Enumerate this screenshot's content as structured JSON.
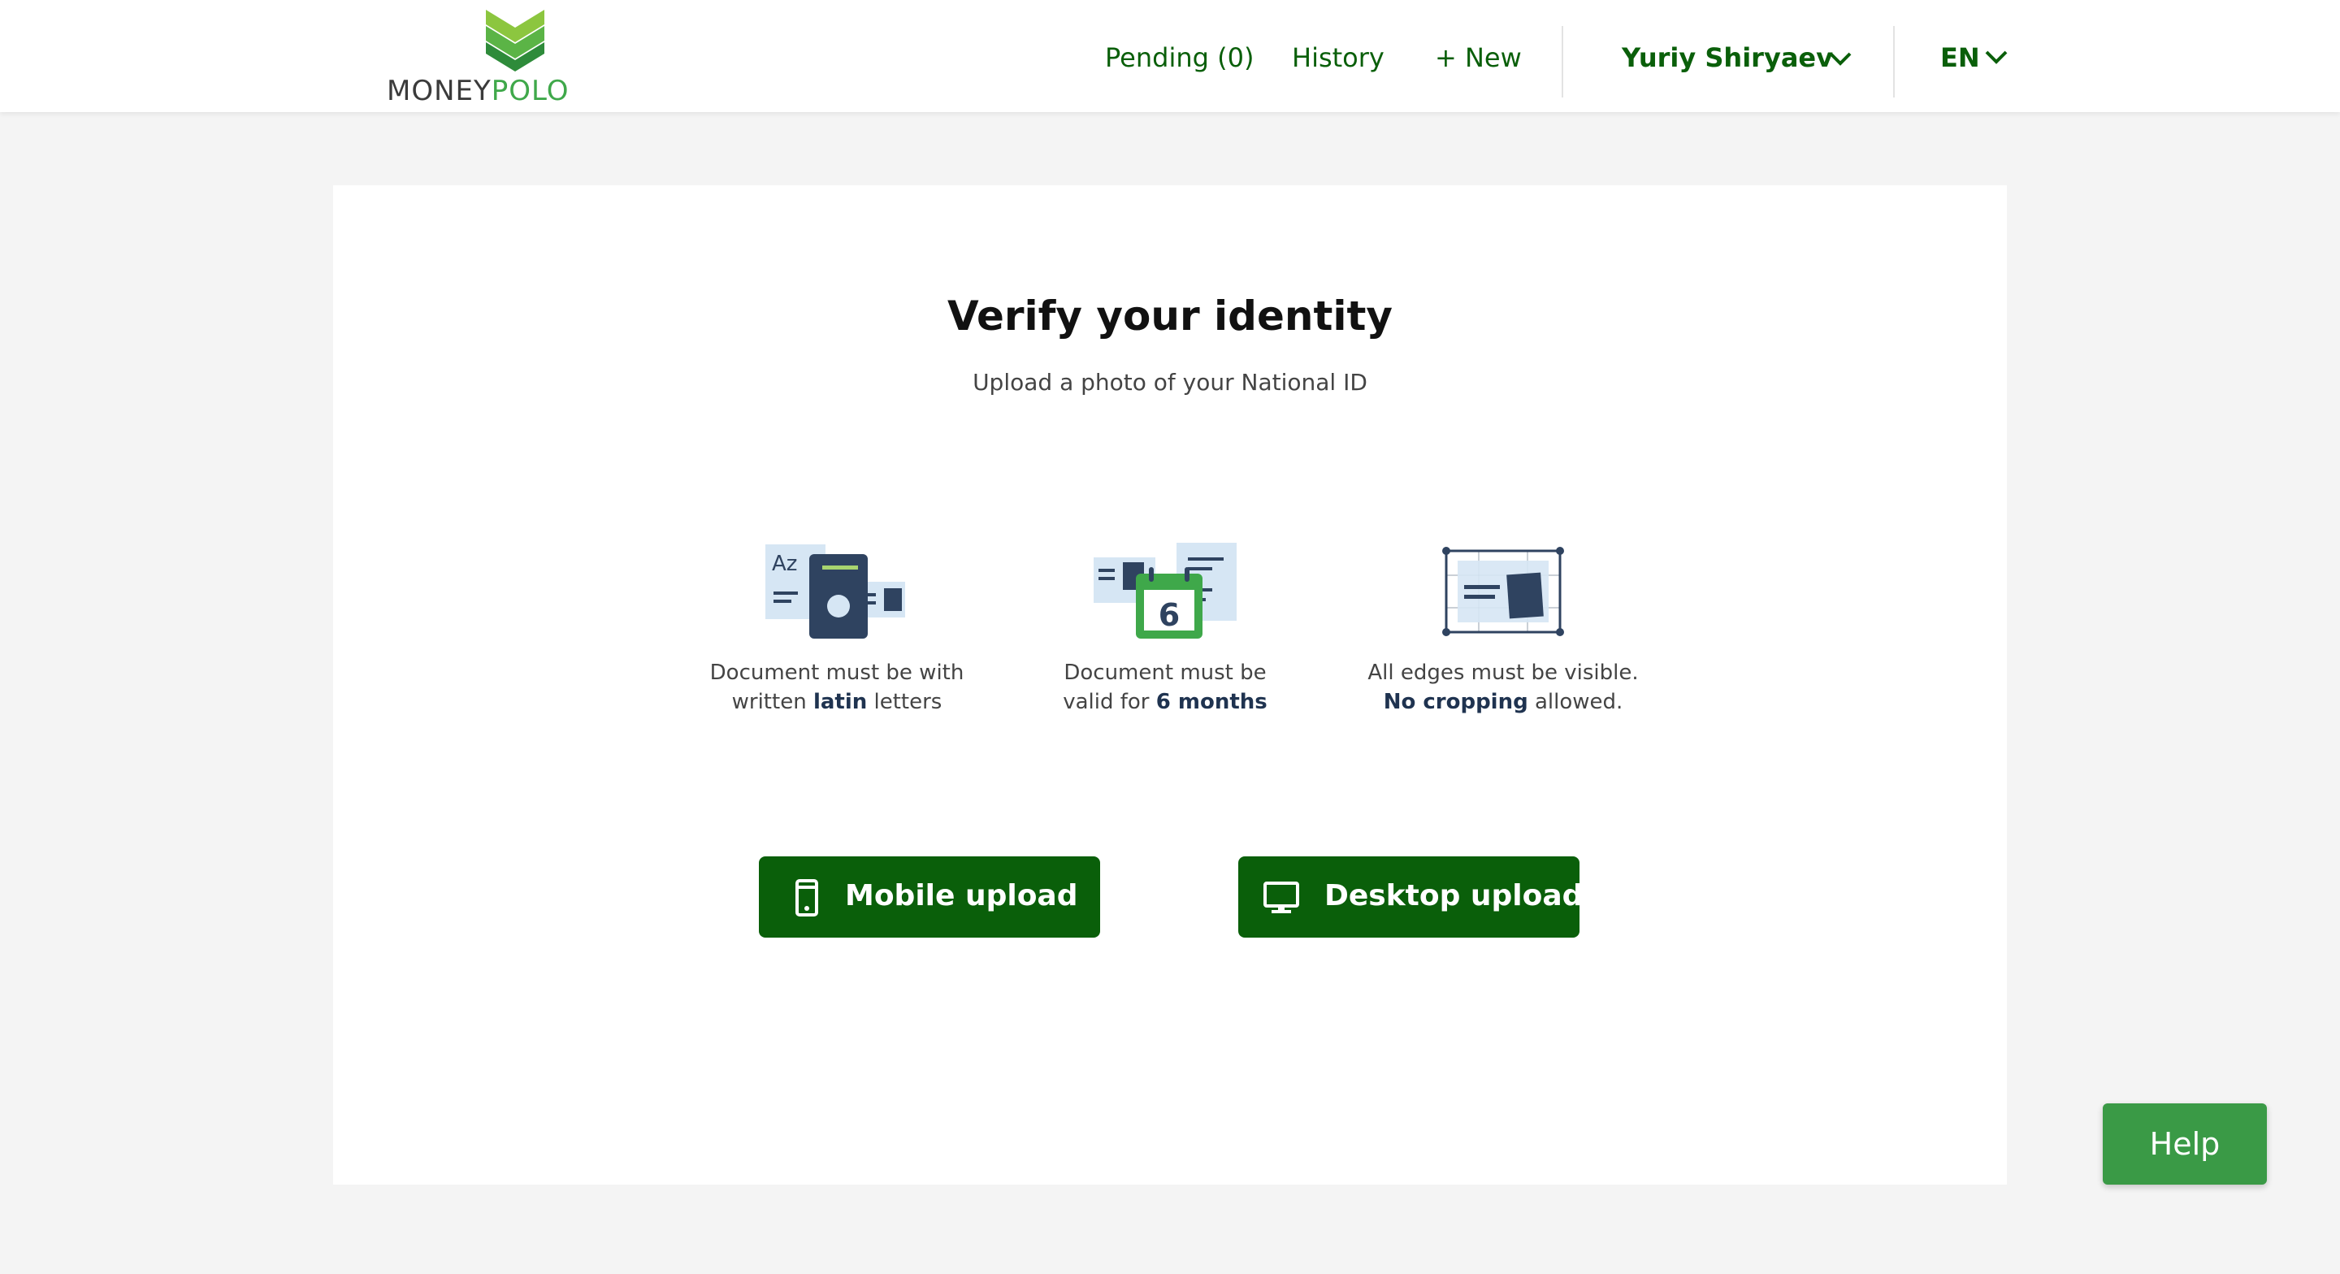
{
  "header": {
    "logo": {
      "word1": "MONEY",
      "word2": "POLO"
    },
    "nav": {
      "pending": "Pending (0)",
      "history": "History",
      "new": "+ New"
    },
    "user_name": "Yuriy Shiryaev",
    "language": "EN"
  },
  "main": {
    "title": "Verify your identity",
    "subtitle": "Upload a photo of your National ID",
    "requirements": [
      {
        "icon": "passport-latin-icon",
        "line1": "Document must be with",
        "line2_pre": "written ",
        "line2_bold": "latin",
        "line2_post": " letters"
      },
      {
        "icon": "calendar-validity-icon",
        "calendar_day": "6",
        "line1": "Document must be",
        "line2_pre": "valid for ",
        "line2_bold": "6 months",
        "line2_post": ""
      },
      {
        "icon": "document-edges-icon",
        "line1": "All edges must be visible.",
        "line2_pre": "",
        "line2_bold": "No cropping",
        "line2_post": " allowed."
      }
    ],
    "buttons": {
      "mobile": "Mobile upload",
      "desktop": "Desktop upload"
    }
  },
  "help_label": "Help",
  "colors": {
    "brand_dark_green": "#0a5f0a",
    "brand_green": "#3fa84a",
    "help_green": "#3a9a46",
    "navy": "#2f4360",
    "page_bg": "#f4f4f4"
  }
}
